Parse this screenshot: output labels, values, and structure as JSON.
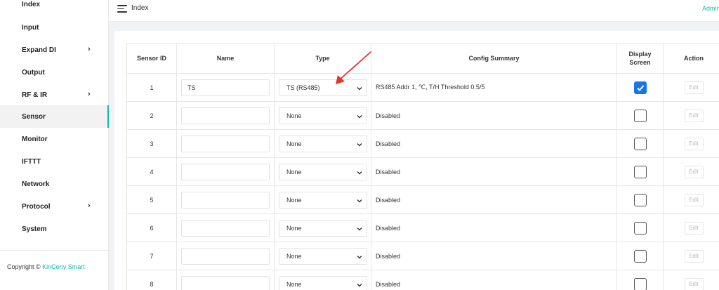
{
  "sidebar": {
    "items": [
      {
        "label": "Index",
        "has_chevron": false,
        "active": false
      },
      {
        "label": "Input",
        "has_chevron": false,
        "active": false
      },
      {
        "label": "Expand DI",
        "has_chevron": true,
        "active": false
      },
      {
        "label": "Output",
        "has_chevron": false,
        "active": false
      },
      {
        "label": "RF & IR",
        "has_chevron": true,
        "active": false
      },
      {
        "label": "Sensor",
        "has_chevron": false,
        "active": true
      },
      {
        "label": "Monitor",
        "has_chevron": false,
        "active": false
      },
      {
        "label": "IFTTT",
        "has_chevron": false,
        "active": false
      },
      {
        "label": "Network",
        "has_chevron": false,
        "active": false
      },
      {
        "label": "Protocol",
        "has_chevron": true,
        "active": false
      },
      {
        "label": "System",
        "has_chevron": false,
        "active": false
      }
    ],
    "copyright_prefix": "Copyright ©",
    "copyright_brand": "KinCony Smart"
  },
  "header": {
    "title": "Index",
    "admin_label": "Admin"
  },
  "table": {
    "headers": {
      "sensor_id": "Sensor ID",
      "name": "Name",
      "type": "Type",
      "config_summary": "Config Summary",
      "display_screen_line1": "Display",
      "display_screen_line2": "Screen",
      "action": "Action"
    },
    "rows": [
      {
        "id": "1",
        "name": "TS",
        "type": "TS (RS485)",
        "summary": "RS485 Addr 1, ℃, T/H Threshold 0.5/5",
        "display_screen": true,
        "action": "Edit"
      },
      {
        "id": "2",
        "name": "",
        "type": "None",
        "summary": "Disabled",
        "display_screen": false,
        "action": "Edit"
      },
      {
        "id": "3",
        "name": "",
        "type": "None",
        "summary": "Disabled",
        "display_screen": false,
        "action": "Edit"
      },
      {
        "id": "4",
        "name": "",
        "type": "None",
        "summary": "Disabled",
        "display_screen": false,
        "action": "Edit"
      },
      {
        "id": "5",
        "name": "",
        "type": "None",
        "summary": "Disabled",
        "display_screen": false,
        "action": "Edit"
      },
      {
        "id": "6",
        "name": "",
        "type": "None",
        "summary": "Disabled",
        "display_screen": false,
        "action": "Edit"
      },
      {
        "id": "7",
        "name": "",
        "type": "None",
        "summary": "Disabled",
        "display_screen": false,
        "action": "Edit"
      },
      {
        "id": "8",
        "name": "",
        "type": "None",
        "summary": "Disabled",
        "display_screen": false,
        "action": "Edit"
      }
    ]
  },
  "colors": {
    "accent": "#16baaa",
    "checkbox_checked": "#1a73e8",
    "annotation_arrow": "#e8322c"
  }
}
